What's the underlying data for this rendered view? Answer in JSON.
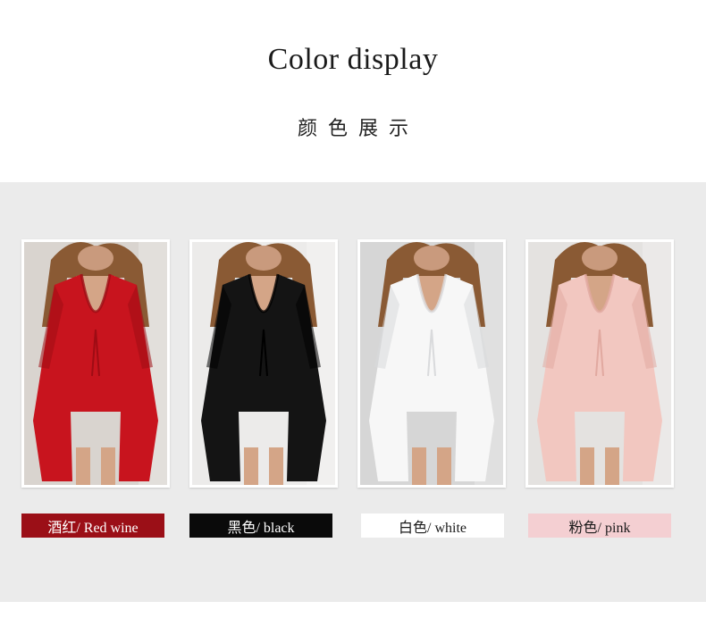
{
  "header": {
    "title": "Color display",
    "subtitle": "颜色展示"
  },
  "colors": [
    {
      "label": "酒红/ Red wine",
      "label_bg": "#9b0f17",
      "label_fg": "#ffffff",
      "garment": "#c8141e",
      "garment_dark": "#9e0c14",
      "bg": "#d9d4cf"
    },
    {
      "label": "黑色/ black",
      "label_bg": "#0a0a0a",
      "label_fg": "#ffffff",
      "garment": "#141414",
      "garment_dark": "#000000",
      "bg": "#ecebea"
    },
    {
      "label": "白色/ white",
      "label_bg": "#ffffff",
      "label_fg": "#1a1a1a",
      "garment": "#f7f7f7",
      "garment_dark": "#d9dadc",
      "bg": "#d6d6d6"
    },
    {
      "label": "粉色/ pink",
      "label_bg": "#f4cfd2",
      "label_fg": "#1a1a1a",
      "garment": "#f2c7c0",
      "garment_dark": "#e1a9a0",
      "bg": "#e4e2e0"
    }
  ]
}
